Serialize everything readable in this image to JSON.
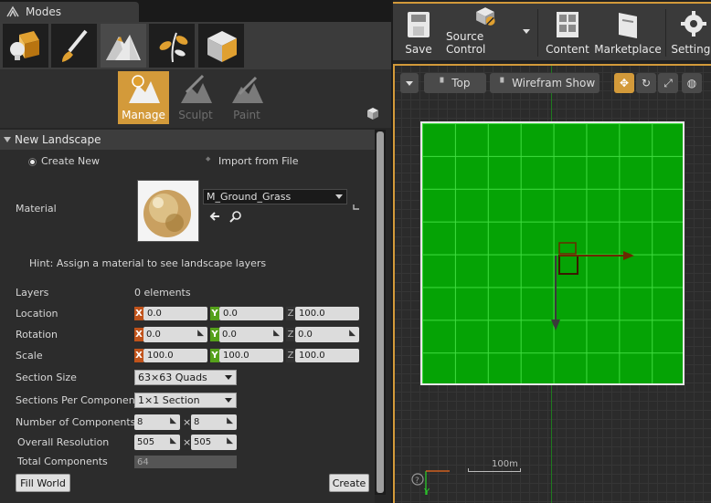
{
  "modes_panel": {
    "tab_title": "Modes",
    "mode_icons": [
      "place-mode-icon",
      "paint-mode-icon",
      "landscape-mode-icon",
      "foliage-mode-icon",
      "geometry-mode-icon"
    ],
    "tools": [
      {
        "label": "Manage",
        "active": true
      },
      {
        "label": "Sculpt",
        "active": false
      },
      {
        "label": "Paint",
        "active": false
      }
    ],
    "section_title": "New Landscape",
    "radio_create": "Create New",
    "radio_import": "Import from File",
    "material_label": "Material",
    "material_value": "M_Ground_Grass",
    "hint": "Hint: Assign a material to see landscape layers",
    "layers_label": "Layers",
    "layers_value": "0 elements",
    "location_label": "Location",
    "location": {
      "x": "0.0",
      "y": "0.0",
      "z": "100.0"
    },
    "rotation_label": "Rotation",
    "rotation": {
      "x": "0.0",
      "y": "0.0",
      "z": "0.0"
    },
    "scale_label": "Scale",
    "scale": {
      "x": "100.0",
      "y": "100.0",
      "z": "100.0"
    },
    "axis": {
      "x": "X",
      "y": "Y",
      "z": "Z"
    },
    "section_size_label": "Section Size",
    "section_size_value": "63×63 Quads",
    "sections_per_component_label": "Sections Per Component",
    "sections_per_component_value": "1×1 Section",
    "num_components_label": "Number of Components",
    "num_components": {
      "x": "8",
      "y": "8"
    },
    "overall_resolution_label": "Overall Resolution",
    "overall_resolution": {
      "x": "505",
      "y": "505"
    },
    "times": "×",
    "total_components_label": "Total Components",
    "total_components_value": "64",
    "fill_world": "Fill World",
    "create": "Create"
  },
  "toolbar": {
    "save": "Save",
    "source_control": "Source Control",
    "content": "Content",
    "marketplace": "Marketplace",
    "settings": "Settings"
  },
  "viewport": {
    "view": "Top",
    "view_mode": "Wireframe",
    "show": "Show",
    "scale_label": "100m",
    "y_axis_label": "Y",
    "colors": {
      "landscape": "#05a305",
      "grid": "#3fdc3f",
      "accent": "#d39a3a"
    }
  }
}
